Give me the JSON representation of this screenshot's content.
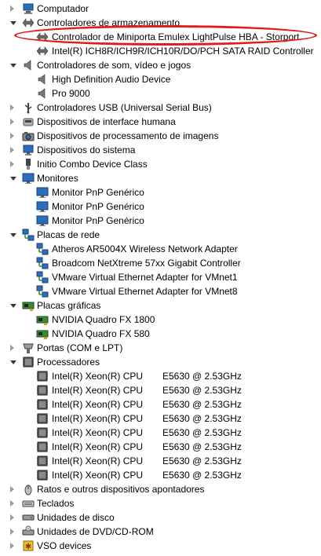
{
  "rows": [
    {
      "level": 1,
      "expander": "closed",
      "icon": "computer-icon",
      "label": "Computador"
    },
    {
      "level": 1,
      "expander": "open",
      "icon": "storage-controller-icon",
      "label": "Controladores de armazenamento"
    },
    {
      "level": 2,
      "expander": "none",
      "icon": "storage-controller-icon",
      "label": "Controlador de Miniporta Emulex LightPulse HBA - Storport"
    },
    {
      "level": 2,
      "expander": "none",
      "icon": "storage-controller-icon",
      "label": "Intel(R) ICH8R/ICH9R/ICH10R/DO/PCH SATA RAID Controller"
    },
    {
      "level": 1,
      "expander": "open",
      "icon": "speaker-icon",
      "label": "Controladores de som, vídeo e jogos"
    },
    {
      "level": 2,
      "expander": "none",
      "icon": "speaker-icon",
      "label": "High Definition Audio Device"
    },
    {
      "level": 2,
      "expander": "none",
      "icon": "speaker-icon",
      "label": "Pro 9000"
    },
    {
      "level": 1,
      "expander": "closed",
      "icon": "usb-icon",
      "label": "Controladores USB (Universal Serial Bus)"
    },
    {
      "level": 1,
      "expander": "closed",
      "icon": "hid-icon",
      "label": "Dispositivos de interface humana"
    },
    {
      "level": 1,
      "expander": "closed",
      "icon": "imaging-icon",
      "label": "Dispositivos de processamento de imagens"
    },
    {
      "level": 1,
      "expander": "closed",
      "icon": "system-devices-icon",
      "label": "Dispositivos do sistema"
    },
    {
      "level": 1,
      "expander": "closed",
      "icon": "combo-device-icon",
      "label": "Initio Combo Device Class"
    },
    {
      "level": 1,
      "expander": "open",
      "icon": "monitor-icon",
      "label": "Monitores"
    },
    {
      "level": 2,
      "expander": "none",
      "icon": "monitor-icon",
      "label": "Monitor PnP Genérico"
    },
    {
      "level": 2,
      "expander": "none",
      "icon": "monitor-icon",
      "label": "Monitor PnP Genérico"
    },
    {
      "level": 2,
      "expander": "none",
      "icon": "monitor-icon",
      "label": "Monitor PnP Genérico"
    },
    {
      "level": 1,
      "expander": "open",
      "icon": "network-icon",
      "label": "Placas de rede"
    },
    {
      "level": 2,
      "expander": "none",
      "icon": "network-icon",
      "label": "Atheros AR5004X Wireless Network Adapter"
    },
    {
      "level": 2,
      "expander": "none",
      "icon": "network-icon",
      "label": "Broadcom NetXtreme 57xx Gigabit Controller"
    },
    {
      "level": 2,
      "expander": "none",
      "icon": "network-icon",
      "label": "VMware Virtual Ethernet Adapter for VMnet1"
    },
    {
      "level": 2,
      "expander": "none",
      "icon": "network-icon",
      "label": "VMware Virtual Ethernet Adapter for VMnet8"
    },
    {
      "level": 1,
      "expander": "open",
      "icon": "display-adapter-icon",
      "label": "Placas gráficas"
    },
    {
      "level": 2,
      "expander": "none",
      "icon": "display-adapter-icon",
      "label": "NVIDIA Quadro FX 1800"
    },
    {
      "level": 2,
      "expander": "none",
      "icon": "display-adapter-icon",
      "label": "NVIDIA Quadro FX 580"
    },
    {
      "level": 1,
      "expander": "closed",
      "icon": "port-icon",
      "label": "Portas (COM e LPT)"
    },
    {
      "level": 1,
      "expander": "open",
      "icon": "processor-icon",
      "label": "Processadores"
    },
    {
      "level": 2,
      "expander": "none",
      "icon": "processor-icon",
      "label": "Intel(R) Xeon(R) CPU",
      "freq": "E5630  @ 2.53GHz"
    },
    {
      "level": 2,
      "expander": "none",
      "icon": "processor-icon",
      "label": "Intel(R) Xeon(R) CPU",
      "freq": "E5630  @ 2.53GHz"
    },
    {
      "level": 2,
      "expander": "none",
      "icon": "processor-icon",
      "label": "Intel(R) Xeon(R) CPU",
      "freq": "E5630  @ 2.53GHz"
    },
    {
      "level": 2,
      "expander": "none",
      "icon": "processor-icon",
      "label": "Intel(R) Xeon(R) CPU",
      "freq": "E5630  @ 2.53GHz"
    },
    {
      "level": 2,
      "expander": "none",
      "icon": "processor-icon",
      "label": "Intel(R) Xeon(R) CPU",
      "freq": "E5630  @ 2.53GHz"
    },
    {
      "level": 2,
      "expander": "none",
      "icon": "processor-icon",
      "label": "Intel(R) Xeon(R) CPU",
      "freq": "E5630  @ 2.53GHz"
    },
    {
      "level": 2,
      "expander": "none",
      "icon": "processor-icon",
      "label": "Intel(R) Xeon(R) CPU",
      "freq": "E5630  @ 2.53GHz"
    },
    {
      "level": 2,
      "expander": "none",
      "icon": "processor-icon",
      "label": "Intel(R) Xeon(R) CPU",
      "freq": "E5630  @ 2.53GHz"
    },
    {
      "level": 1,
      "expander": "closed",
      "icon": "mouse-icon",
      "label": "Ratos e outros dispositivos apontadores"
    },
    {
      "level": 1,
      "expander": "closed",
      "icon": "keyboard-icon",
      "label": "Teclados"
    },
    {
      "level": 1,
      "expander": "closed",
      "icon": "disk-drive-icon",
      "label": "Unidades de disco"
    },
    {
      "level": 1,
      "expander": "closed",
      "icon": "dvd-drive-icon",
      "label": "Unidades de DVD/CD-ROM"
    },
    {
      "level": 1,
      "expander": "closed",
      "icon": "vso-device-icon",
      "label": "VSO devices"
    }
  ],
  "highlight_color": "#e31b1b"
}
